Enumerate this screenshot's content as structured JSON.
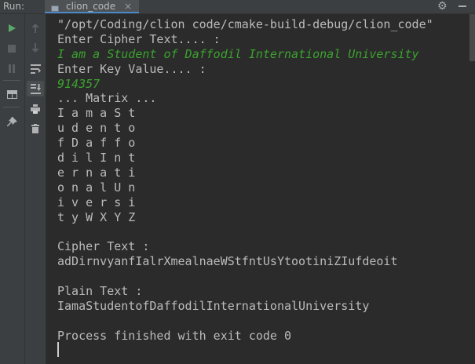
{
  "run_bar": {
    "label": "Run:",
    "tab_label": "clion_code",
    "tab_close": "×",
    "gear": "⚙",
    "tab_underline_color": "#4a88c7"
  },
  "toolbar": {
    "left_icons": [
      "play-icon",
      "stop-icon",
      "pause-icon",
      "layout-icon",
      "pin-icon"
    ],
    "right_icons": [
      "arrow-up-icon",
      "arrow-down-icon",
      "soft-wrap-icon",
      "scroll-to-end-icon",
      "print-icon",
      "trash-icon"
    ]
  },
  "console": {
    "input_color": "#3ba32e",
    "lines": [
      {
        "text": "\"/opt/Coding/clion code/cmake-build-debug/clion_code\"",
        "kind": "out"
      },
      {
        "text": "Enter Cipher Text.... :",
        "kind": "out"
      },
      {
        "text": "I am a Student of Daffodil International University",
        "kind": "input"
      },
      {
        "text": "Enter Key Value.... :",
        "kind": "out"
      },
      {
        "text": "914357",
        "kind": "input"
      },
      {
        "text": "... Matrix ...",
        "kind": "out"
      },
      {
        "text": "I a m a S t",
        "kind": "out"
      },
      {
        "text": "u d e n t o",
        "kind": "out"
      },
      {
        "text": "f D a f f o",
        "kind": "out"
      },
      {
        "text": "d i l I n t",
        "kind": "out"
      },
      {
        "text": "e r n a t i",
        "kind": "out"
      },
      {
        "text": "o n a l U n",
        "kind": "out"
      },
      {
        "text": "i v e r s i",
        "kind": "out"
      },
      {
        "text": "t y W X Y Z",
        "kind": "out"
      },
      {
        "text": "",
        "kind": "out"
      },
      {
        "text": "Cipher Text :",
        "kind": "out"
      },
      {
        "text": "adDirnvyanfIalrXmealnaeWStfntUsYtootiniZIufdeoit",
        "kind": "out"
      },
      {
        "text": "",
        "kind": "out"
      },
      {
        "text": "Plain Text :",
        "kind": "out"
      },
      {
        "text": "IamaStudentofDaffodilInternationalUniversity",
        "kind": "out"
      },
      {
        "text": "",
        "kind": "out"
      },
      {
        "text": "Process finished with exit code 0",
        "kind": "out"
      }
    ]
  }
}
